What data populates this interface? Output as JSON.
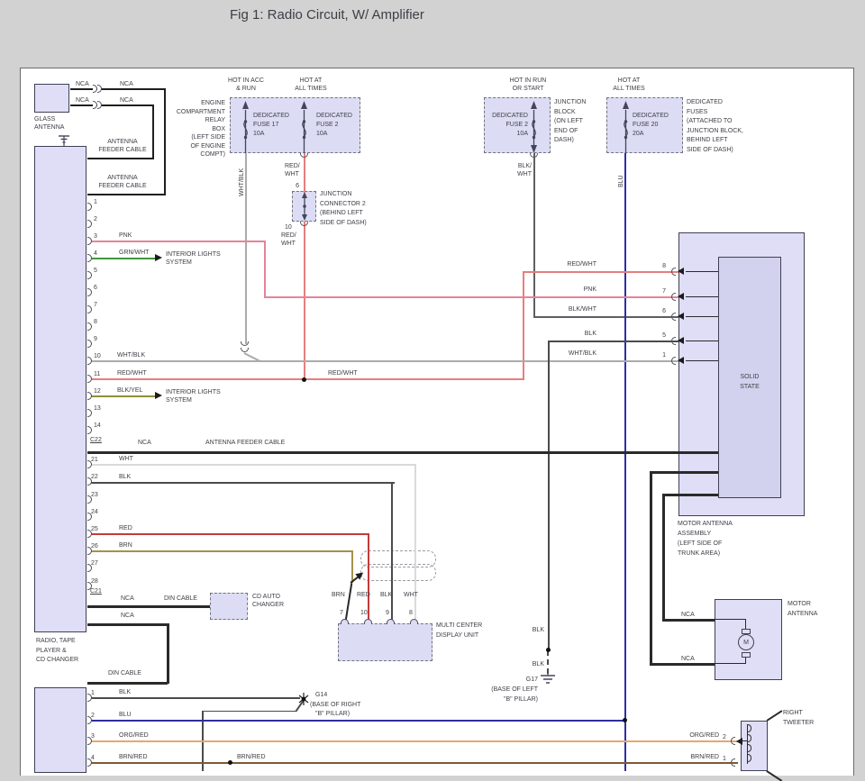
{
  "title": "Fig 1: Radio Circuit, W/ Amplifier",
  "colors": {
    "page_bg": "#d2d2d2",
    "canvas": "#ffffff",
    "box_fill": "#dfdef6",
    "box_fill_dashed": "#dcdcf4",
    "amp_inner_fill": "#d2d2ee",
    "box_border": "#3f3f55",
    "pnk": "#e4849a",
    "red_wht": "#e57f7f",
    "red": "#c23b3b",
    "grn_wht": "#43953f",
    "blk_yel": "#8f8f35",
    "wht": "#dadada",
    "blk": "#4b4b4b",
    "wht_blk": "#ababab",
    "blk_wht": "#5f5f63",
    "brn": "#a6914c",
    "blu": "#2e2ea0",
    "org_red": "#e5a86b",
    "brn_red": "#7d5a35"
  },
  "nca": "NCA",
  "din_cable": "DIN CABLE",
  "antenna_feeder_cable": "ANTENNA FEEDER CABLE",
  "glass_antenna": {
    "l1": "GLASS",
    "l2": "ANTENNA"
  },
  "feeder": {
    "l1": "ANTENNA",
    "l2": "FEEDER CABLE"
  },
  "engine_box": {
    "lines": [
      "ENGINE",
      "COMPARTMENT",
      "RELAY",
      "BOX",
      "(LEFT SIDE",
      "OF ENGINE",
      "COMPT)"
    ]
  },
  "hot_acc": {
    "l1": "HOT IN ACC",
    "l2": "& RUN"
  },
  "hot_all_1": {
    "l1": "HOT AT",
    "l2": "ALL TIMES"
  },
  "hot_run": {
    "l1": "HOT IN RUN",
    "l2": "OR START"
  },
  "hot_all_2": {
    "l1": "HOT AT",
    "l2": "ALL TIMES"
  },
  "fuse17": {
    "l1": "DEDICATED",
    "l2": "FUSE 17",
    "l3": "10A"
  },
  "fuse2_engine": {
    "l1": "DEDICATED",
    "l2": "FUSE 2",
    "l3": "10A"
  },
  "fuse2_dash": {
    "l1": "DEDICATED",
    "l2": "FUSE 2",
    "l3": "10A"
  },
  "fuse20": {
    "l1": "DEDICATED",
    "l2": "FUSE 20",
    "l3": "20A"
  },
  "junction_block": {
    "lines": [
      "JUNCTION",
      "BLOCK",
      "(ON LEFT",
      "END OF",
      "DASH)"
    ]
  },
  "dedicated_fuses": {
    "lines": [
      "DEDICATED",
      "FUSES",
      "(ATTACHED TO",
      "JUNCTION BLOCK,",
      "BEHIND LEFT",
      "SIDE OF DASH)"
    ]
  },
  "jc2": {
    "pin_top": "6",
    "pin_bottom": "10",
    "lines": [
      "JUNCTION",
      "CONNECTOR 2",
      "(BEHIND LEFT",
      "SIDE OF DASH)"
    ]
  },
  "wires": {
    "wht_blk": "WHT/BLK",
    "blu": "BLU",
    "pnk": "PNK",
    "grn_wht": "GRN/WHT",
    "blk_yel": "BLK/YEL",
    "red_wht": "RED/WHT",
    "wht": "WHT",
    "blk": "BLK",
    "red": "RED",
    "brn": "BRN",
    "org_red": "ORG/RED",
    "brn_red": "BRN/RED",
    "red_wht_2": {
      "l1": "RED/",
      "l2": "WHT"
    },
    "blk_wht_2": {
      "l1": "BLK/",
      "l2": "WHT"
    },
    "blk_wht": "BLK/WHT"
  },
  "interior_lights": {
    "l1": "INTERIOR LIGHTS",
    "l2": "SYSTEM"
  },
  "radio": {
    "label": [
      "RADIO, TAPE",
      "PLAYER &",
      "CD CHANGER"
    ],
    "c22": "C22",
    "c21": "C21",
    "c22_pins": [
      "1",
      "2",
      "3",
      "4",
      "5",
      "6",
      "7",
      "8",
      "9",
      "10",
      "11",
      "12",
      "13",
      "14"
    ],
    "c21_pins": [
      "21",
      "22",
      "23",
      "24",
      "25",
      "26",
      "27",
      "28"
    ],
    "bottom_pins": [
      "1",
      "2",
      "3",
      "4"
    ]
  },
  "cd_changer": {
    "l1": "CD AUTO",
    "l2": "CHANGER"
  },
  "amp": {
    "labels": [
      "RED/WHT",
      "PNK",
      "BLK/WHT",
      "BLK",
      "WHT/BLK"
    ],
    "pins": [
      "8",
      "7",
      "6",
      "5",
      "1"
    ],
    "solid": "SOLID",
    "state": "STATE",
    "assembly": [
      "MOTOR ANTENNA",
      "ASSEMBLY",
      "(LEFT SIDE OF",
      "TRUNK AREA)"
    ]
  },
  "mcd": {
    "wire_labels": [
      "BRN",
      "RED",
      "BLK",
      "WHT"
    ],
    "pins": [
      "7",
      "10",
      "9",
      "8"
    ],
    "l1": "MULTI CENTER",
    "l2": "DISPLAY UNIT"
  },
  "motor_antenna": {
    "l1": "MOTOR",
    "l2": "ANTENNA",
    "m": "M"
  },
  "g17": {
    "l1": "G17",
    "l2": "(BASE OF LEFT",
    "l3": "\"B\" PILLAR)"
  },
  "g14": {
    "l1": "G14",
    "l2": "(BASE OF RIGHT",
    "l3": "\"B\" PILLAR)"
  },
  "tweeter": {
    "l1": "RIGHT",
    "l2": "TWEETER",
    "pin2": "2",
    "pin1": "1"
  }
}
